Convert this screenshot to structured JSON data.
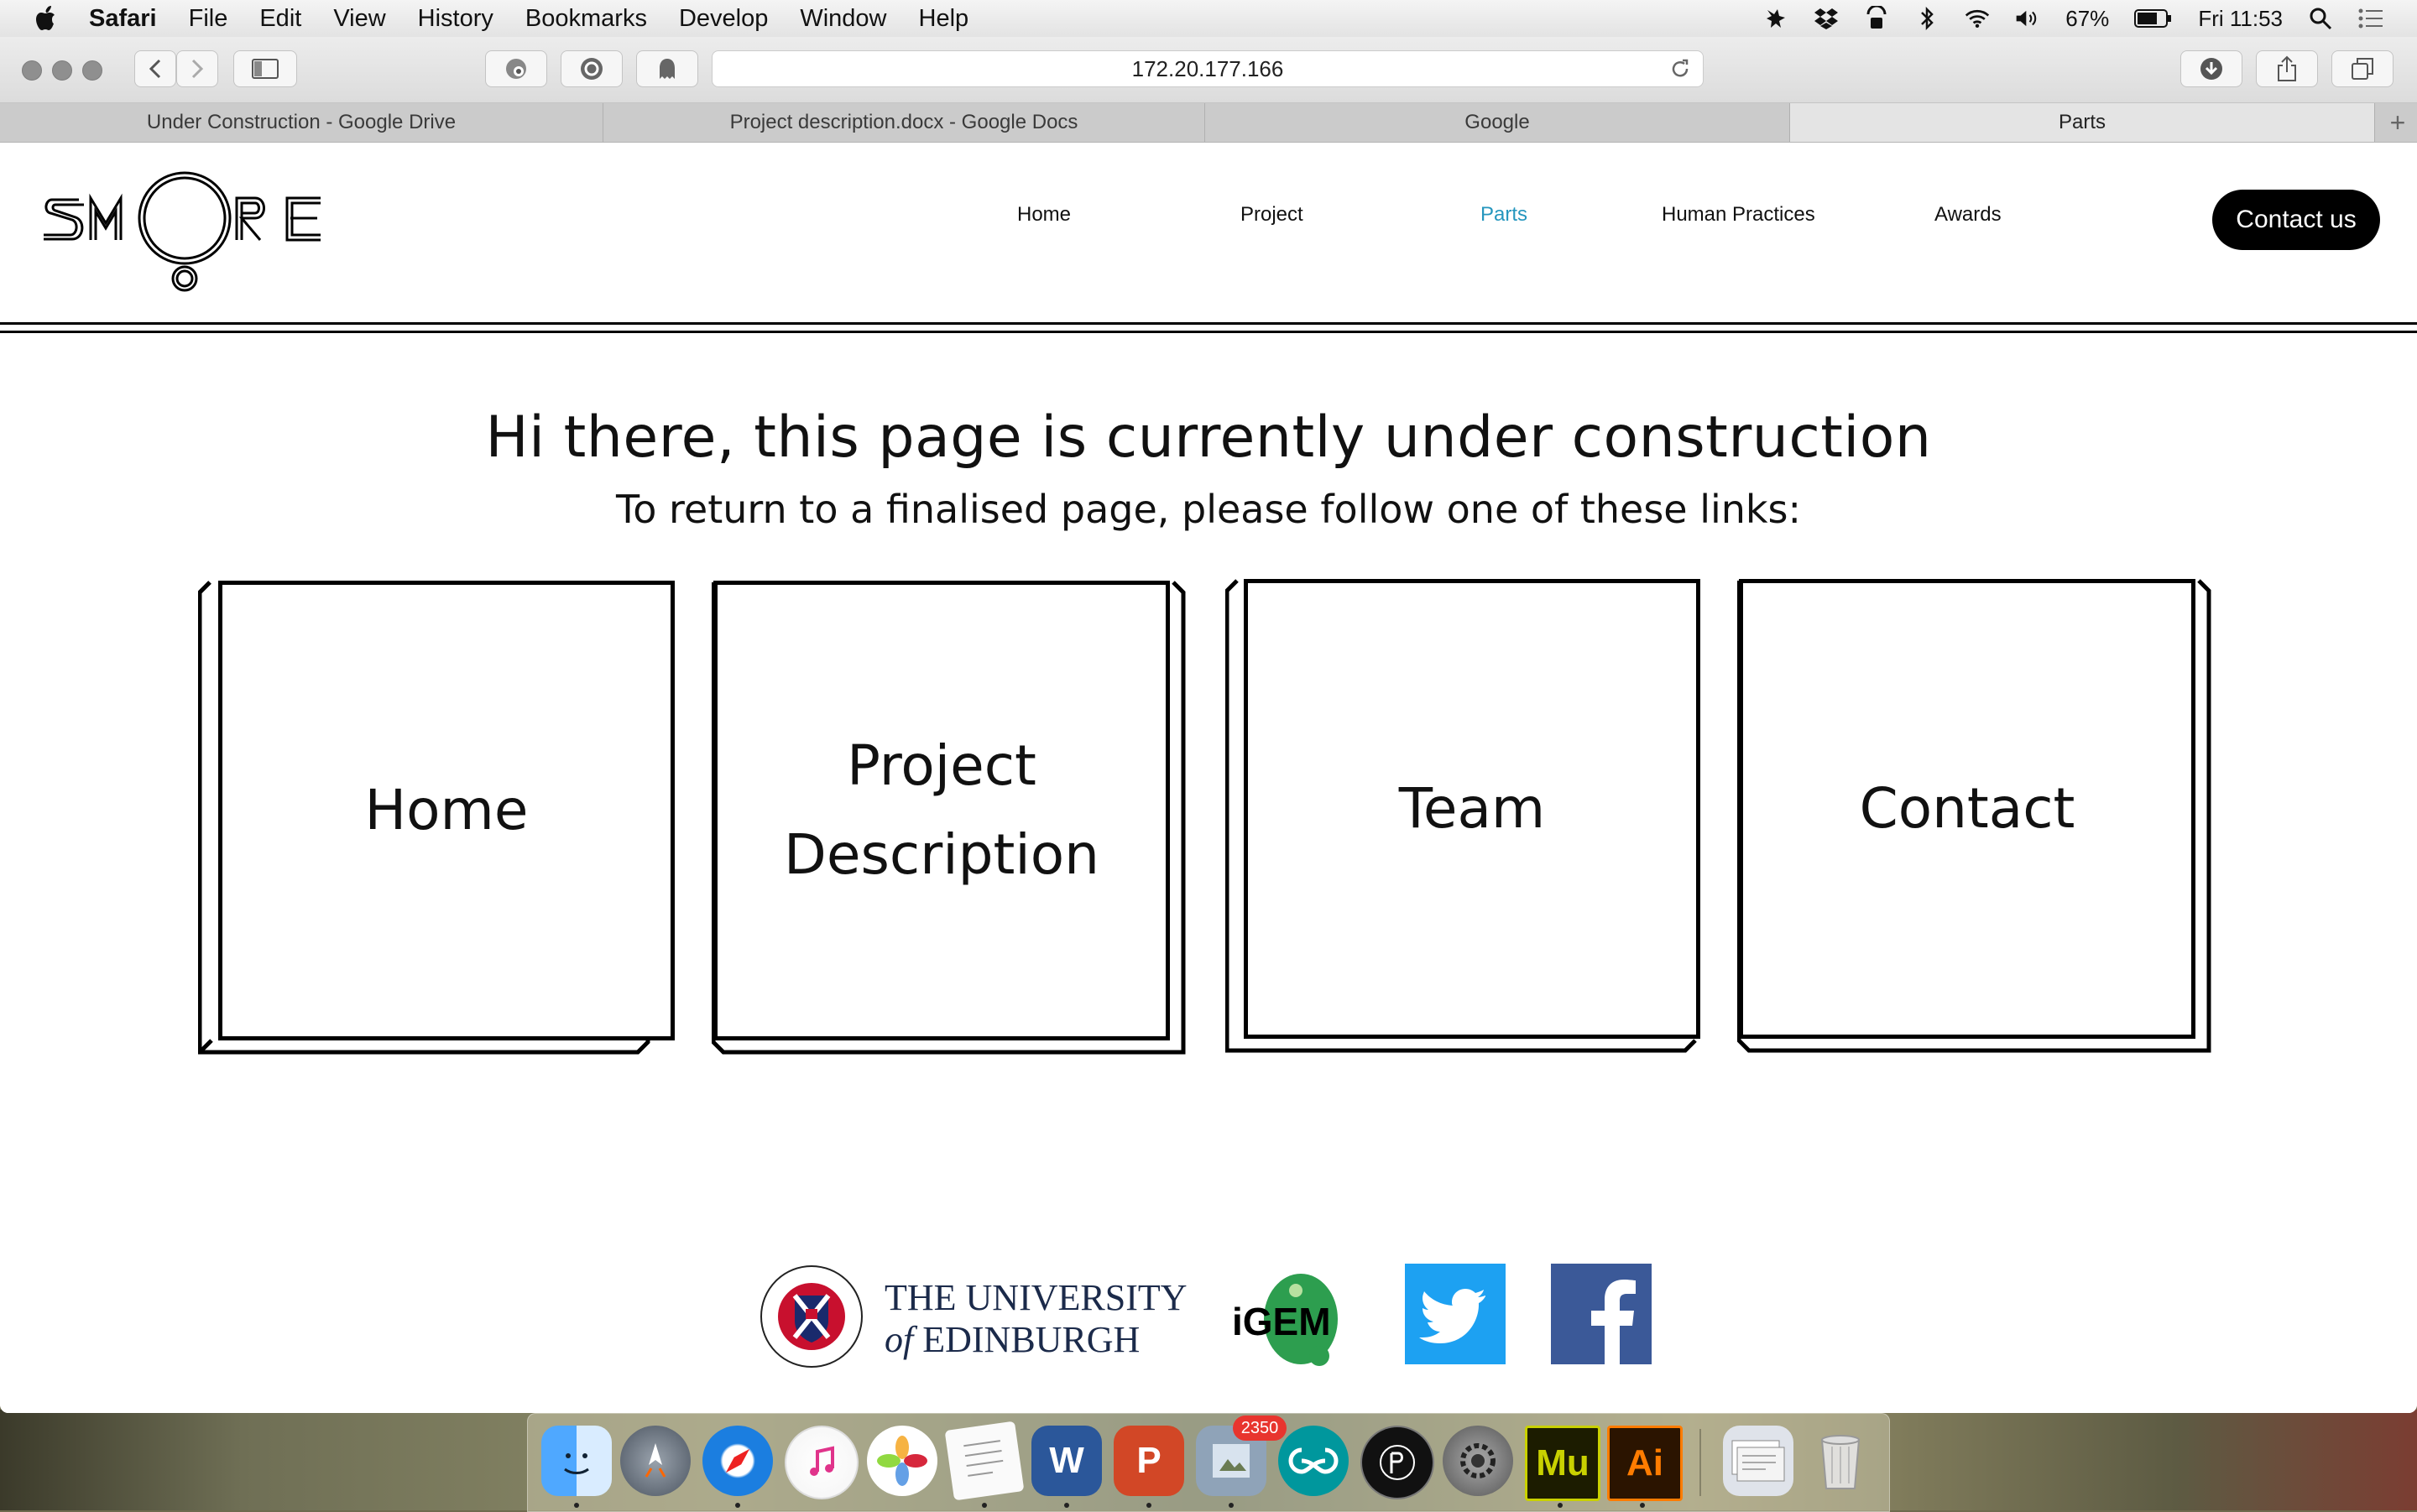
{
  "menubar": {
    "app_name": "Safari",
    "items": [
      "File",
      "Edit",
      "View",
      "History",
      "Bookmarks",
      "Develop",
      "Window",
      "Help"
    ],
    "battery": "67%",
    "clock": "Fri 11:53"
  },
  "browser": {
    "url": "172.20.177.166",
    "tabs": [
      {
        "title": "Under Construction - Google Drive",
        "active": false
      },
      {
        "title": "Project description.docx - Google Docs",
        "active": false
      },
      {
        "title": "Google",
        "active": false
      },
      {
        "title": "Parts",
        "active": true
      }
    ],
    "new_tab": "+"
  },
  "site": {
    "logo_text": "SMORE",
    "nav": [
      "Home",
      "Project",
      "Parts",
      "Human Practices",
      "Awards"
    ],
    "nav_active": "Parts",
    "contact_button": "Contact us",
    "headline": "Hi there, this page is currently under construction",
    "subline": "To return to a finalised page, please follow one of these links:",
    "cards": [
      {
        "line1": "Home",
        "line2": ""
      },
      {
        "line1": "Project",
        "line2": "Description"
      },
      {
        "line1": "Team",
        "line2": ""
      },
      {
        "line1": "Contact",
        "line2": ""
      }
    ],
    "footer": {
      "university_line1": "THE UNIVERSITY",
      "university_line2_italic": "of",
      "university_line2": "EDINBURGH",
      "igem": "iGEM"
    }
  },
  "dock": {
    "mail_badge": "2350",
    "apps": [
      "Finder",
      "Launchpad",
      "Safari",
      "iTunes",
      "Photos",
      "TextEdit",
      "Word",
      "PowerPoint",
      "Preview",
      "Arduino",
      "P3",
      "System Preferences",
      "Muse",
      "Illustrator",
      "Downloads",
      "Trash"
    ],
    "labels": {
      "word": "W",
      "powerpoint": "P",
      "muse": "Mu",
      "illustrator": "Ai"
    }
  },
  "colors": {
    "accent_nav": "#2596be",
    "contact_bg": "#000000",
    "twitter": "#1da1f2",
    "facebook": "#3b5998",
    "igem_green": "#2d9e4f"
  }
}
